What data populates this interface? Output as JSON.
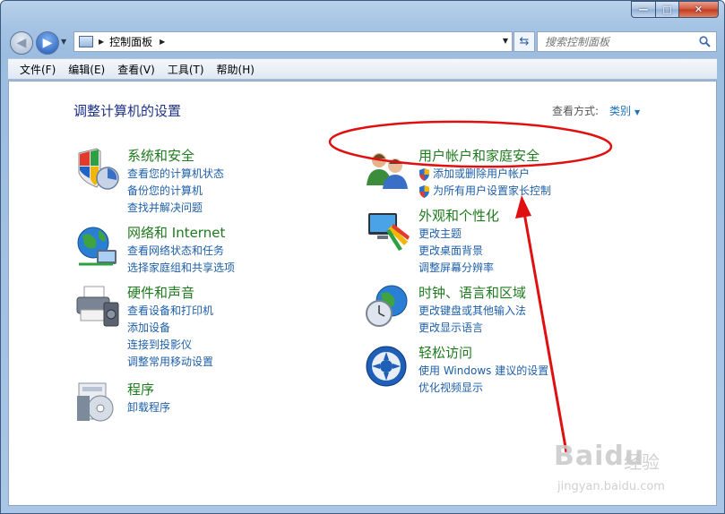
{
  "window": {
    "minimize_glyph": "—",
    "maximize_glyph": "□",
    "close_glyph": "✕"
  },
  "address_bar": {
    "breadcrumb": "控制面板",
    "search_placeholder": "搜索控制面板"
  },
  "menu": {
    "items": [
      "文件(F)",
      "编辑(E)",
      "查看(V)",
      "工具(T)",
      "帮助(H)"
    ]
  },
  "main": {
    "title": "调整计算机的设置",
    "view_by_label": "查看方式:",
    "view_by_value": "类别"
  },
  "categories": [
    {
      "title": "系统和安全",
      "icon": "system-security-icon",
      "links": [
        "查看您的计算机状态",
        "备份您的计算机",
        "查找并解决问题"
      ]
    },
    {
      "title": "网络和 Internet",
      "icon": "network-icon",
      "links": [
        "查看网络状态和任务",
        "选择家庭组和共享选项"
      ]
    },
    {
      "title": "硬件和声音",
      "icon": "printer-icon",
      "links": [
        "查看设备和打印机",
        "添加设备",
        "连接到投影仪",
        "调整常用移动设置"
      ]
    },
    {
      "title": "程序",
      "icon": "programs-icon",
      "links": [
        "卸载程序"
      ]
    },
    {
      "title": "用户帐户和家庭安全",
      "icon": "users-icon",
      "links": [
        "添加或删除用户帐户",
        "为所有用户设置家长控制"
      ]
    },
    {
      "title": "外观和个性化",
      "icon": "appearance-icon",
      "links": [
        "更改主题",
        "更改桌面背景",
        "调整屏幕分辨率"
      ]
    },
    {
      "title": "时钟、语言和区域",
      "icon": "clock-globe-icon",
      "links": [
        "更改键盘或其他输入法",
        "更改显示语言"
      ]
    },
    {
      "title": "轻松访问",
      "icon": "ease-of-access-icon",
      "links": [
        "使用 Windows 建议的设置",
        "优化视频显示"
      ]
    }
  ],
  "watermark": {
    "brand": "Baidu",
    "text": "经验",
    "url": "jingyan.baidu.com"
  },
  "colors": {
    "category_title": "#1e7a1e",
    "link": "#1e5fa8",
    "page_title": "#1e3287",
    "annotation": "#e01010"
  }
}
